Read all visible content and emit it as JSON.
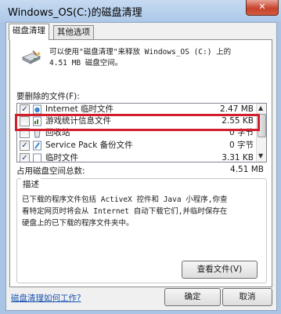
{
  "window": {
    "title": "Windows_OS(C:)的磁盘清理",
    "close_glyph": "✕"
  },
  "tabs": [
    {
      "label": "磁盘清理"
    },
    {
      "label": "其他选项"
    }
  ],
  "intro": "可以使用\"磁盘清理\"来释放 Windows_OS (C:) 上的\n4.51 MB 磁盘空间。",
  "files_label": "要删除的文件(F):",
  "files": [
    {
      "name": "Internet 临时文件",
      "size": "2.47 MB",
      "checked": true,
      "icon": "internet-files-icon"
    },
    {
      "name": "游戏统计信息文件",
      "size": "2.55 KB",
      "checked": false,
      "icon": "game-stats-icon"
    },
    {
      "name": "回收站",
      "size": "0 字节",
      "checked": false,
      "icon": "recycle-bin-icon"
    },
    {
      "name": "Service Pack 备份文件",
      "size": "0 字节",
      "checked": true,
      "icon": "backup-files-icon"
    },
    {
      "name": "临时文件",
      "size": "3.31 KB",
      "checked": true,
      "icon": "temp-files-icon"
    }
  ],
  "total_label": "占用磁盘空间总数:",
  "total_value": "4.51 MB",
  "description_label": "描述",
  "description": "已下载的程序文件包括 ActiveX 控件和 Java 小程序,你查\n看特定网页时将会从 Internet 自动下载它们,并临时保存在\n硬盘上的已下载的程序文件夹中。",
  "view_files_button": "查看文件(V)",
  "help_link": "磁盘清理如何工作?",
  "ok_button": "确定",
  "cancel_button": "取消",
  "check_glyph": "✓",
  "highlight_color": "#d21f2c"
}
